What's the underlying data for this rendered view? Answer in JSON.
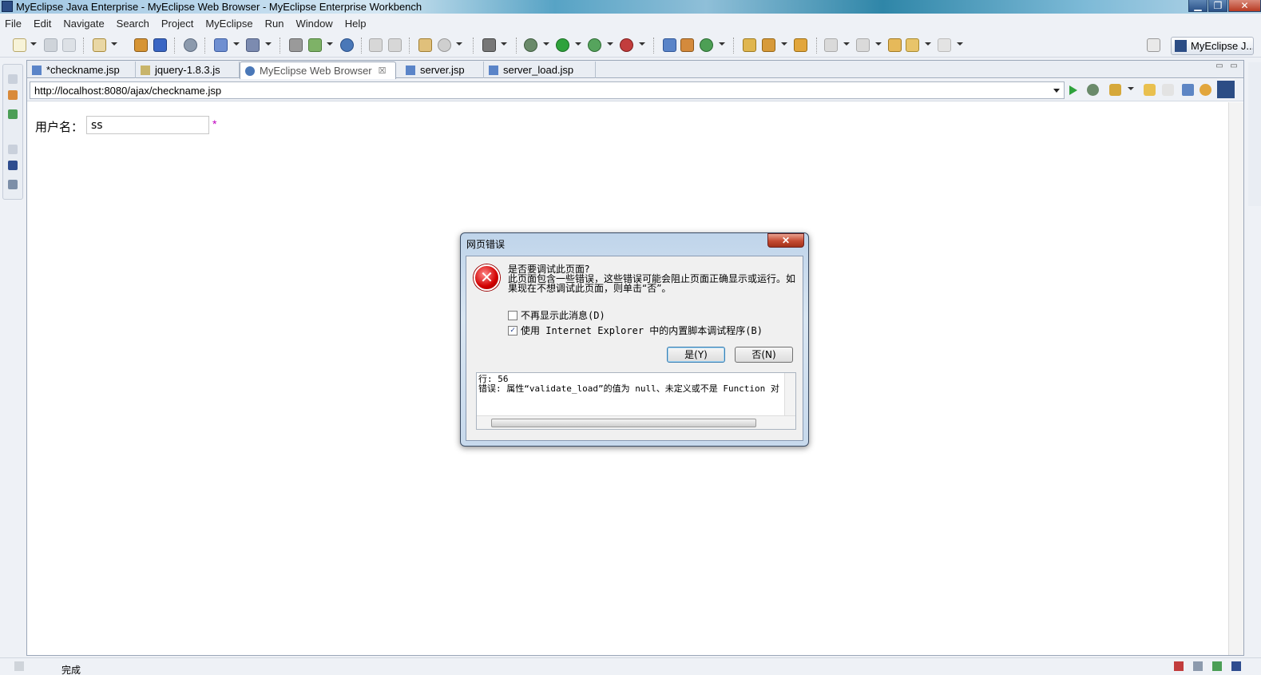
{
  "window": {
    "title": "MyEclipse Java Enterprise - MyEclipse Web Browser - MyEclipse Enterprise Workbench",
    "minimize": "▁",
    "maximize": "❐",
    "close": "✕"
  },
  "menubar": {
    "items": [
      "File",
      "Edit",
      "Navigate",
      "Search",
      "Project",
      "MyEclipse",
      "Run",
      "Window",
      "Help"
    ]
  },
  "perspective": {
    "label": "MyEclipse J..."
  },
  "editor": {
    "tabs": [
      {
        "label": "*checkname.jsp",
        "icon": "jsp-file-icon",
        "active": false
      },
      {
        "label": "jquery-1.8.3.js",
        "icon": "js-file-icon",
        "active": false
      },
      {
        "label": "MyEclipse Web Browser",
        "icon": "globe-icon",
        "active": true,
        "close": "☒"
      },
      {
        "label": "server.jsp",
        "icon": "jsp-file-icon",
        "active": false
      },
      {
        "label": "server_load.jsp",
        "icon": "jsp-file-icon",
        "active": false
      }
    ],
    "view_minimize": "▭",
    "view_maximize": "▭"
  },
  "browser": {
    "url": "http://localhost:8080/ajax/checkname.jsp"
  },
  "page": {
    "username_label": "用户名：",
    "username_value": "ss",
    "required_mark": "*"
  },
  "dialog": {
    "title": "网页错误",
    "close": "✕",
    "icon": "error-icon",
    "message": "是否要调试此页面?\n此页面包含一些错误，这些错误可能会阻止页面正确显示或运行。如果现在不想调试此页面，则单击“否”。",
    "checkbox_1": {
      "label": "不再显示此消息(D)",
      "checked": false
    },
    "checkbox_2": {
      "label": "使用 Internet Explorer 中的内置脚本调试程序(B)",
      "checked": true
    },
    "yes_button": "是(Y)",
    "no_button": "否(N)",
    "error_detail": "行: 56\n错误: 属性“validate_load”的值为 null、未定义或不是 Function 对"
  },
  "status": {
    "text": "完成"
  },
  "colors": {
    "accent": "#2c4d85",
    "error_red": "#d10000",
    "required_star": "#c000c0"
  }
}
